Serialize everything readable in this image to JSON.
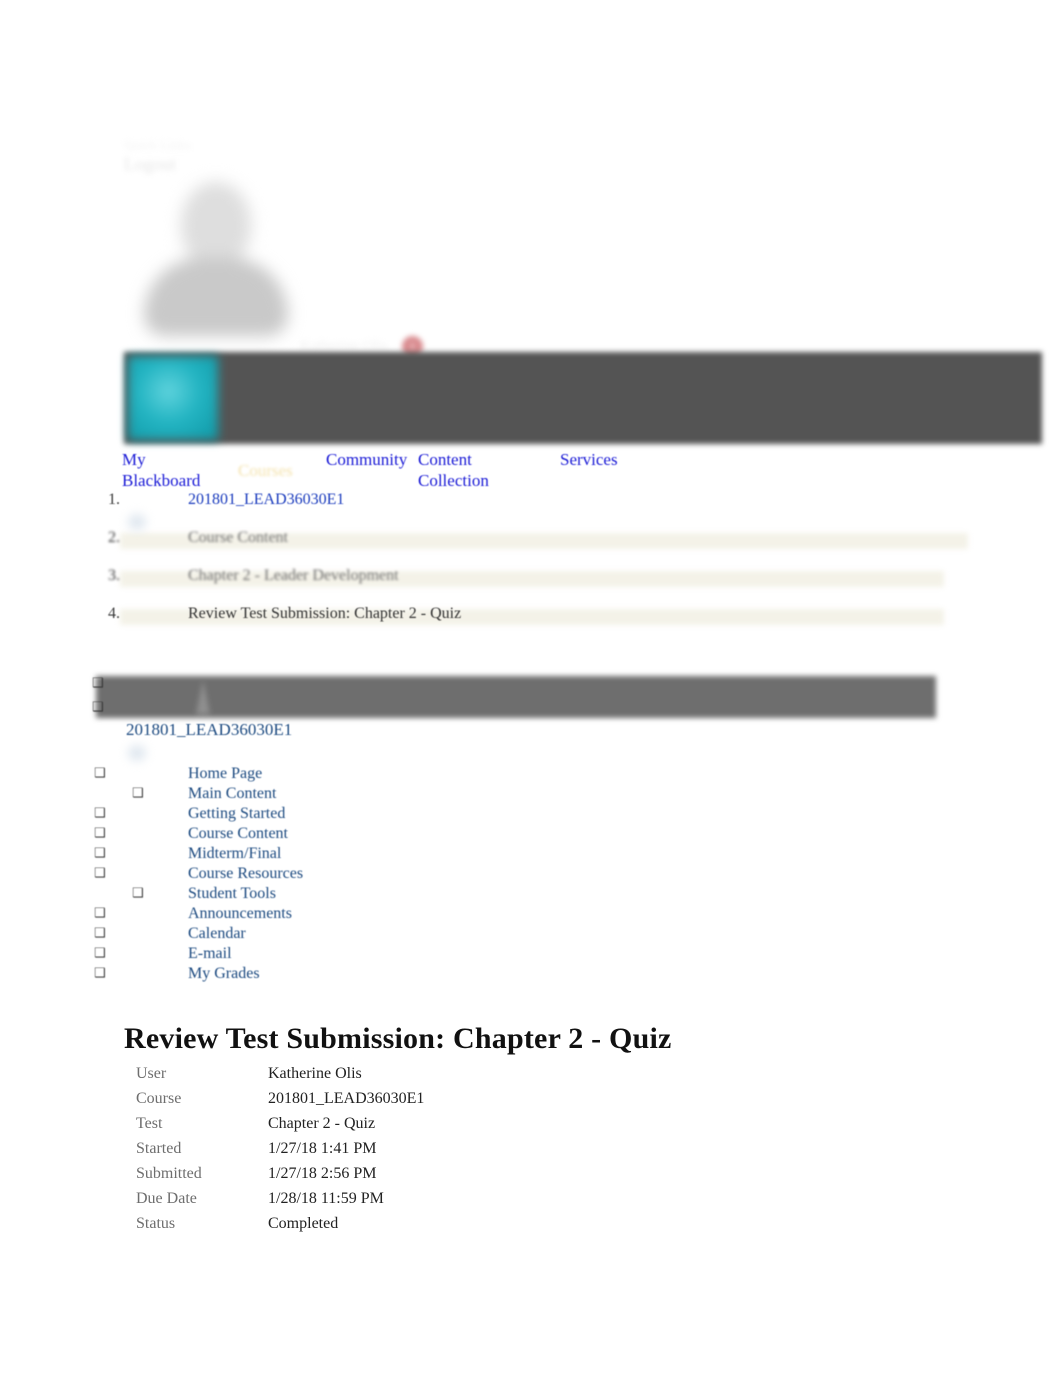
{
  "quick_links": {
    "label": "Quick Links",
    "logout_label": "Logout"
  },
  "user": {
    "name": "Katherine Olis",
    "notification_count": "1",
    "avatar_icon": "user-silhouette-icon"
  },
  "brand": {
    "tile_color": "#23b4c2",
    "header_bar_color": "#545454"
  },
  "topnav": {
    "items": [
      {
        "label": "My Blackboard",
        "active": false
      },
      {
        "label": "Courses",
        "active": true
      },
      {
        "label": "Community",
        "active": false
      },
      {
        "label": "Content Collection",
        "active": false
      },
      {
        "label": "Services",
        "active": false
      }
    ]
  },
  "breadcrumb": {
    "items": [
      {
        "label": "201801_LEAD36030E1",
        "style": "link"
      },
      {
        "label": "Course Content",
        "style": "muted"
      },
      {
        "label": "Chapter 2 - Leader Development",
        "style": "muted"
      },
      {
        "label": "Review Test Submission: Chapter 2 - Quiz",
        "style": "current"
      }
    ]
  },
  "course_menu": {
    "course_id": "201801_LEAD36030E1",
    "bullet_glyph": "❑",
    "items": [
      {
        "label": "Home Page",
        "indent": false
      },
      {
        "label": "Main Content",
        "indent": true
      },
      {
        "label": "Getting Started",
        "indent": false
      },
      {
        "label": "Course Content",
        "indent": false
      },
      {
        "label": "Midterm/Final",
        "indent": false
      },
      {
        "label": "Course Resources",
        "indent": false
      },
      {
        "label": "Student Tools",
        "indent": true
      },
      {
        "label": "Announcements",
        "indent": false
      },
      {
        "label": "Calendar",
        "indent": false
      },
      {
        "label": "E-mail",
        "indent": false
      },
      {
        "label": "My Grades",
        "indent": false
      }
    ]
  },
  "main": {
    "title": "Review Test Submission: Chapter 2 - Quiz",
    "details": [
      {
        "key": "User",
        "value": "Katherine Olis"
      },
      {
        "key": "Course",
        "value": "201801_LEAD36030E1"
      },
      {
        "key": "Test",
        "value": "Chapter 2 - Quiz"
      },
      {
        "key": "Started",
        "value": "1/27/18 1:41 PM"
      },
      {
        "key": "Submitted",
        "value": "1/27/18 2:56 PM"
      },
      {
        "key": "Due Date",
        "value": "1/28/18 11:59 PM"
      },
      {
        "key": "Status",
        "value": "Completed"
      }
    ]
  }
}
